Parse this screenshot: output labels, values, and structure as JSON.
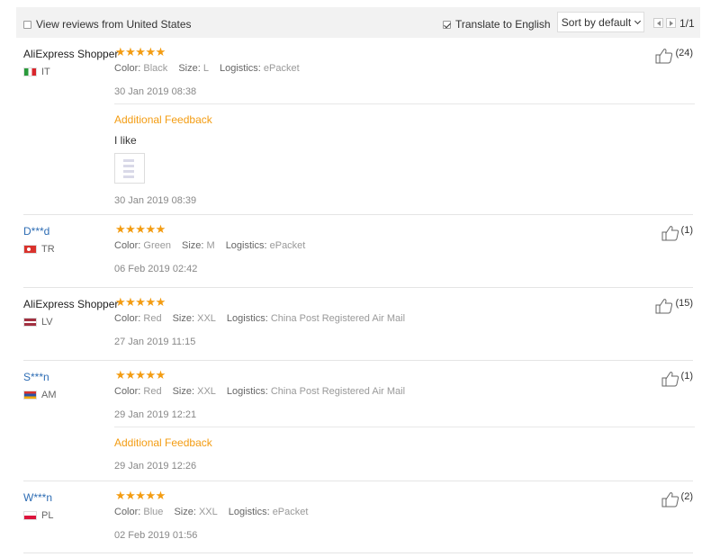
{
  "toolbar": {
    "view_us_label": "View reviews from United States",
    "view_us_checked": false,
    "translate_label": "Translate to English",
    "translate_checked": true,
    "sort_label": "Sort by default",
    "page_count": "1/1"
  },
  "labels": {
    "color": "Color:",
    "size": "Size:",
    "logistics": "Logistics:"
  },
  "reviews": [
    {
      "user": "AliExpress Shopper",
      "country": "IT",
      "stars": "★★★★★",
      "color": "Black",
      "size": "L",
      "logistics": "ePacket",
      "date": "30 Jan 2019 08:38",
      "likes": "(24)",
      "additional": {
        "title": "Additional Feedback",
        "text": "I like",
        "date": "30 Jan 2019 08:39"
      }
    },
    {
      "user": "D***d",
      "country": "TR",
      "stars": "★★★★★",
      "color": "Green",
      "size": "M",
      "logistics": "ePacket",
      "date": "06 Feb 2019 02:42",
      "likes": "(1)"
    },
    {
      "user": "AliExpress Shopper",
      "country": "LV",
      "stars": "★★★★★",
      "color": "Red",
      "size": "XXL",
      "logistics": "China Post Registered Air Mail",
      "date": "27 Jan 2019 11:15",
      "likes": "(15)"
    },
    {
      "user": "S***n",
      "country": "AM",
      "stars": "★★★★★",
      "color": "Red",
      "size": "XXL",
      "logistics": "China Post Registered Air Mail",
      "date": "29 Jan 2019 12:21",
      "likes": "(1)",
      "additional": {
        "title": "Additional Feedback",
        "date": "29 Jan 2019 12:26"
      }
    },
    {
      "user": "W***n",
      "country": "PL",
      "stars": "★★★★★",
      "color": "Blue",
      "size": "XXL",
      "logistics": "ePacket",
      "date": "02 Feb 2019 01:56",
      "likes": "(2)"
    }
  ]
}
